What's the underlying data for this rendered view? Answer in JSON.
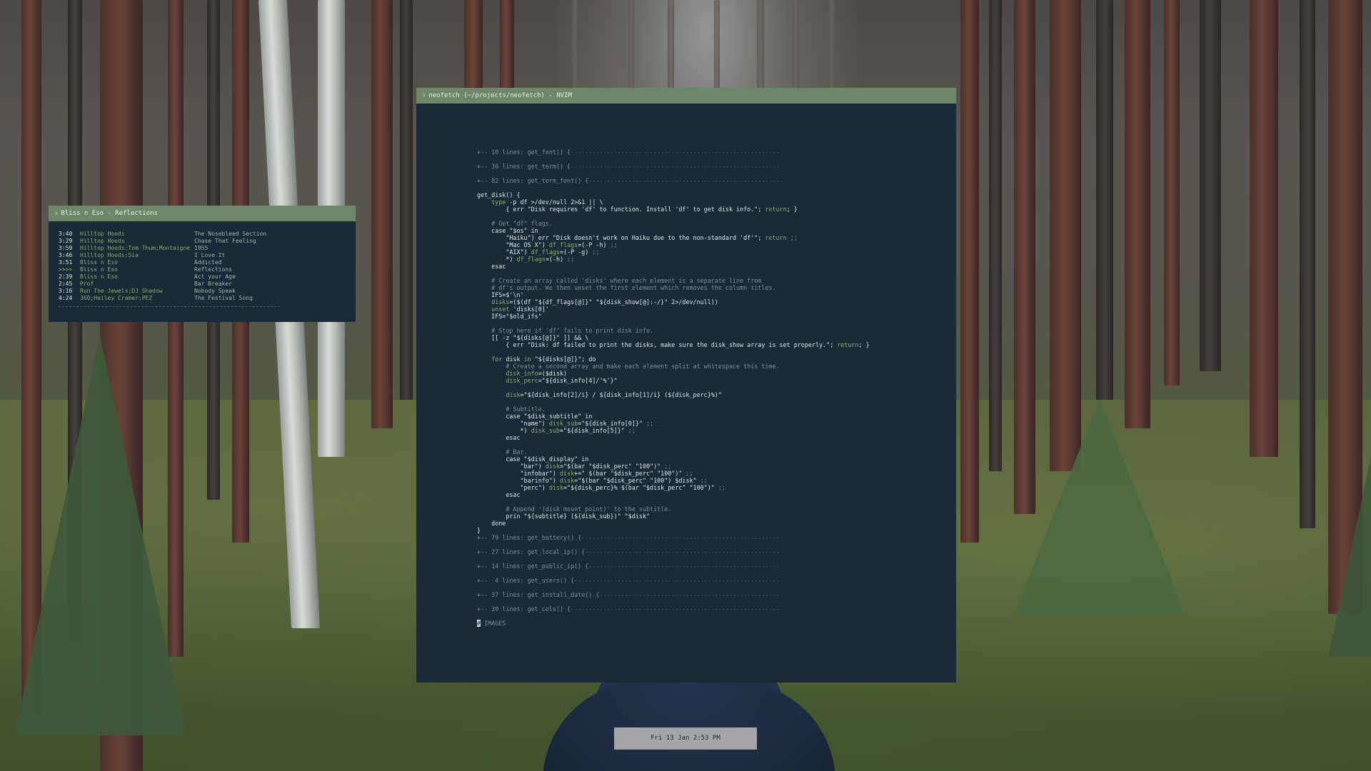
{
  "desktop": {
    "wallpaper": "forest",
    "colors": {
      "titlebar": "#6d8768",
      "window_bg": "#192a39",
      "accent_green": "#94ad67"
    }
  },
  "player": {
    "title": "Bliss n Eso - Reflections",
    "prompt_icon": "chevron-right-icon",
    "tracks": [
      {
        "time": "3:40",
        "artist": "Hilltop Hoods",
        "song": "The Nosebleed Section"
      },
      {
        "time": "3:29",
        "artist": "Hilltop Hoods",
        "song": "Chase That Feeling"
      },
      {
        "time": "3:59",
        "artist": "Hilltop Hoods;Tom Thum;Montaigne",
        "song": "1955"
      },
      {
        "time": "3:46",
        "artist": "Hilltop Hoods;Sia",
        "song": "I Love It"
      },
      {
        "time": "3:51",
        "artist": "Bliss n Eso",
        "song": "Addicted"
      },
      {
        "time": ">>>>",
        "artist": "Bliss n Eso",
        "song": "Reflections"
      },
      {
        "time": "2:39",
        "artist": "Bliss n Eso",
        "song": "Act your Age"
      },
      {
        "time": "2:45",
        "artist": "Prof",
        "song": "Bar Breaker"
      },
      {
        "time": "3:16",
        "artist": "Run The Jewels;DJ Shadow",
        "song": "Nobody Speak"
      },
      {
        "time": "4:24",
        "artist": "360;Hailey Cramer;PEZ",
        "song": "The Festival Song"
      }
    ]
  },
  "nvim": {
    "title": "neofetch (~/projects/neofetch) - NVIM",
    "folds_top": [
      "+-- 10 lines: get_font() {",
      "+-- 30 lines: get_term() {",
      "+-- 82 lines: get_term_font() {"
    ],
    "folds_bottom": [
      "+-- 79 lines: get_battery() {",
      "+-- 27 lines: get_local_ip() {",
      "+-- 14 lines: get_public_ip() {",
      "+--  4 lines: get_users() {",
      "+-- 37 lines: get_install_date() {",
      "+-- 30 lines: get_cols() {"
    ],
    "last_line": "# IMAGES"
  },
  "clock": {
    "text": "Fri 13 Jan  2:53 PM"
  }
}
